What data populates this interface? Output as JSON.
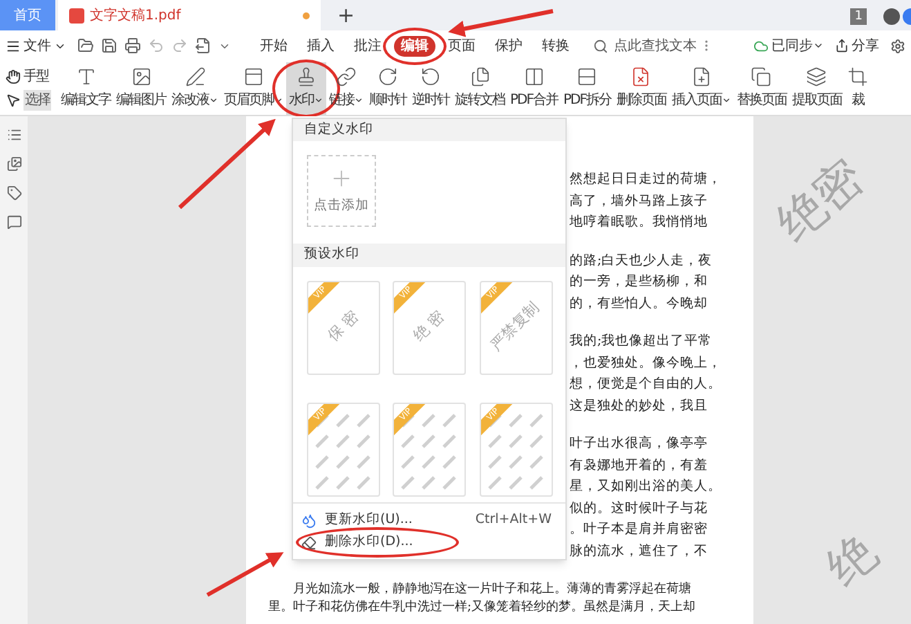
{
  "tabs": [
    {
      "kind": "home",
      "label": "首页",
      "selected": false
    },
    {
      "kind": "doc",
      "label": "文字文稿1.pdf",
      "selected": true,
      "unsaved": true
    }
  ],
  "new_tab": "+",
  "page_count": "1",
  "menu": {
    "file": "文件",
    "tabs": [
      {
        "label": "开始",
        "selected": false
      },
      {
        "label": "插入",
        "selected": false
      },
      {
        "label": "批注",
        "selected": false
      },
      {
        "label": "编辑",
        "selected": true
      },
      {
        "label": "页面",
        "selected": false
      },
      {
        "label": "保护",
        "selected": false
      },
      {
        "label": "转换",
        "selected": false
      }
    ],
    "search": {
      "placeholder": "点此查找文本"
    },
    "sync": "已同步",
    "share": "分享"
  },
  "tools": {
    "hand": "手型",
    "select": {
      "label": "选择",
      "selected": true
    },
    "items": [
      {
        "label": "编辑文字",
        "menu": false,
        "pressed": false
      },
      {
        "label": "编辑图片",
        "menu": false,
        "pressed": false
      },
      {
        "label": "涂改液",
        "menu": true,
        "pressed": false
      },
      {
        "label": "页眉页脚",
        "menu": true,
        "pressed": false
      },
      {
        "label": "水印",
        "menu": true,
        "pressed": true
      },
      {
        "label": "链接",
        "menu": true,
        "pressed": false
      },
      {
        "label": "顺时针",
        "menu": false,
        "pressed": false
      },
      {
        "label": "逆时针",
        "menu": false,
        "pressed": false
      },
      {
        "label": "旋转文档",
        "menu": false,
        "pressed": false
      },
      {
        "label": "PDF合并",
        "menu": false,
        "pressed": false
      },
      {
        "label": "PDF拆分",
        "menu": false,
        "pressed": false
      },
      {
        "label": "删除页面",
        "menu": false,
        "pressed": false
      },
      {
        "label": "插入页面",
        "menu": true,
        "pressed": false
      },
      {
        "label": "替换页面",
        "menu": false,
        "pressed": false
      },
      {
        "label": "提取页面",
        "menu": false,
        "pressed": false
      },
      {
        "label": "裁",
        "menu": false,
        "pressed": false
      }
    ]
  },
  "watermark_menu": {
    "custom_title": "自定义水印",
    "add_label": "点击添加",
    "preset_title": "预设水印",
    "presets": [
      {
        "kind": "single",
        "badge": "VIP",
        "texts": [
          "保 密"
        ]
      },
      {
        "kind": "single",
        "badge": "VIP",
        "texts": [
          "绝 密"
        ]
      },
      {
        "kind": "single",
        "badge": "VIP",
        "texts": [
          "严禁复制"
        ]
      },
      {
        "kind": "tiled",
        "badge": "VIP"
      },
      {
        "kind": "tiled",
        "badge": "VIP"
      },
      {
        "kind": "tiled",
        "badge": "VIP"
      }
    ],
    "actions": [
      {
        "label": "更新水印(U)...",
        "shortcut": "Ctrl+Alt+W"
      },
      {
        "label": "删除水印(D)..."
      }
    ]
  },
  "document": {
    "watermarks": [
      "绝密",
      "绝"
    ],
    "right_lines": [
      [
        "然想起日日走过的荷塘，",
        "高了，墙外马路上孩子",
        "地哼着眠歌。我悄悄地"
      ],
      [
        "的路;白天也少人走，夜",
        "的一旁，是些杨柳，和",
        "的，有些怕人。今晚却"
      ],
      [
        "我的;我也像超出了平常",
        "，也爱独处。像今晚上，",
        "想，便觉是个自由的人。",
        "这是独处的妙处，我且"
      ],
      [
        "叶子出水很高，像亭亭",
        "有袅娜地开着的，有羞",
        "星，又如刚出浴的美人。",
        "似的。这时候叶子与花",
        "。叶子本是肩并肩密密",
        "脉的流水，遮住了，不"
      ]
    ],
    "full_lines": [
      "月光如流水一般，静静地泻在这一片叶子和花上。薄薄的青雾浮起在荷塘",
      "里。叶子和花仿佛在牛乳中洗过一样;又像笼着轻纱的梦。虽然是满月，天上却"
    ]
  }
}
